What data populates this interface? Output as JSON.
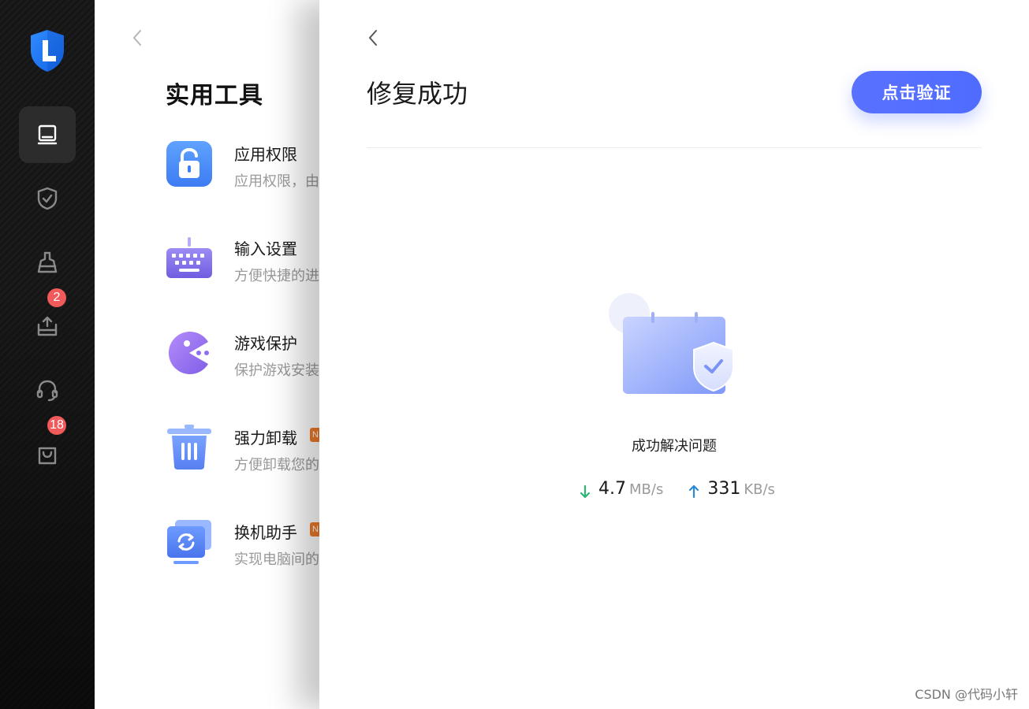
{
  "sidebar": {
    "logo_icon": "shield-L-logo",
    "items": [
      {
        "name": "computer-icon",
        "active": true,
        "badge": ""
      },
      {
        "name": "shield-check-icon",
        "active": false,
        "badge": ""
      },
      {
        "name": "broom-icon",
        "active": false,
        "badge": ""
      },
      {
        "name": "upload-box-icon",
        "active": false,
        "badge": "2"
      },
      {
        "name": "headset-icon",
        "active": false,
        "badge": ""
      },
      {
        "name": "shopping-bag-icon",
        "active": false,
        "badge": "18"
      }
    ]
  },
  "tools_panel": {
    "title": "实用工具",
    "tools": [
      {
        "name": "应用权限",
        "desc": "应用权限，由",
        "icon": "lock-icon",
        "new": false
      },
      {
        "name": "输入设置",
        "desc": "方便快捷的进",
        "icon": "keyboard-icon",
        "new": false
      },
      {
        "name": "游戏保护",
        "desc": "保护游戏安装",
        "icon": "pacman-icon",
        "new": false
      },
      {
        "name": "强力卸载",
        "desc": "方便卸载您的",
        "icon": "trash-icon",
        "new": true,
        "new_label": "N"
      },
      {
        "name": "换机助手",
        "desc": "实现电脑间的",
        "icon": "migrate-icon",
        "new": true,
        "new_label": "N"
      }
    ]
  },
  "result_panel": {
    "title": "修复成功",
    "verify_button": "点击验证",
    "status": "成功解决问题",
    "download": {
      "value": "4.7",
      "unit": "MB/s",
      "color": "#2bb673"
    },
    "upload": {
      "value": "331",
      "unit": "KB/s",
      "color": "#2a8ad8"
    },
    "illustration_icon": "calendar-shield-check-icon"
  },
  "watermark": "CSDN @代码小轩",
  "colors": {
    "accent": "#5068ff",
    "badge": "#f05a5a",
    "sidebar_bg": "#161616"
  }
}
